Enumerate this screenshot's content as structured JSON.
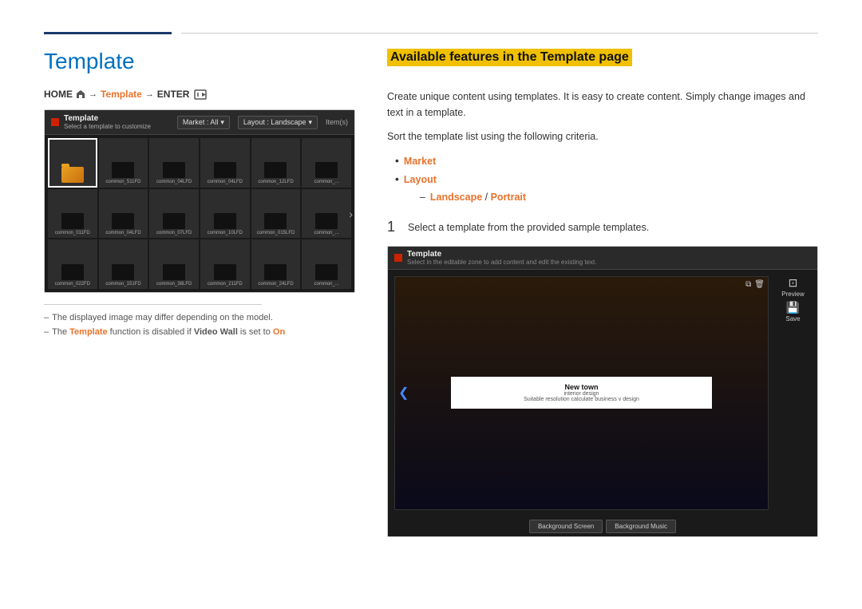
{
  "page": {
    "title": "Template",
    "top_rule_left_width": 160,
    "breadcrumb": {
      "home": "HOME",
      "arrow1": "→",
      "link": "Template",
      "arrow2": "→",
      "enter": "ENTER"
    }
  },
  "left": {
    "mockup": {
      "title": "Template",
      "subtitle": "Select a template to customize",
      "market_dropdown": "Market : All",
      "layout_dropdown": "Layout : Landscape",
      "items_label": "Item(s)",
      "thumbs": [
        {
          "label": "",
          "type": "folder"
        },
        {
          "label": "common_511FD",
          "type": "screen"
        },
        {
          "label": "common_04LFD",
          "type": "screen"
        },
        {
          "label": "common_04LFD",
          "type": "screen"
        },
        {
          "label": "common_12LFD",
          "type": "screen"
        },
        {
          "label": "common_...",
          "type": "screen"
        },
        {
          "label": "common_011FD",
          "type": "screen"
        },
        {
          "label": "common_04LFD",
          "type": "screen"
        },
        {
          "label": "common_07LFD",
          "type": "screen"
        },
        {
          "label": "common_10LFD",
          "type": "screen"
        },
        {
          "label": "common_015LFD",
          "type": "screen"
        },
        {
          "label": "common_...",
          "type": "screen"
        },
        {
          "label": "common_022FD",
          "type": "screen"
        },
        {
          "label": "common_151FD",
          "type": "screen"
        },
        {
          "label": "common_38LFD",
          "type": "screen"
        },
        {
          "label": "common_211FD",
          "type": "screen"
        },
        {
          "label": "common_24LFD",
          "type": "screen"
        },
        {
          "label": "common_...",
          "type": "screen"
        }
      ]
    },
    "notes": [
      {
        "text": "The displayed image may differ depending on the model."
      },
      {
        "text": "The ",
        "highlight_word": "Template",
        "rest": " function is disabled if ",
        "bold_word": "Video Wall",
        "rest2": " is set to ",
        "on_word": "On"
      }
    ]
  },
  "right": {
    "section_title": "Available features in the Template page",
    "description": "Create unique content using templates. It is easy to create content. Simply change images and text in a template.",
    "sort_text": "Sort the template list using the following criteria.",
    "bullets": [
      {
        "label": "Market"
      },
      {
        "label": "Layout",
        "sub": [
          "Landscape / Portrait"
        ]
      }
    ],
    "step1_number": "1",
    "step1_text": "Select a template from the provided sample templates.",
    "mockup2": {
      "title": "Template",
      "subtitle": "Select in the editable zone to add content and edit the existing text.",
      "preview_title": "New town",
      "preview_subtitle": "interior design",
      "preview_tagline": "Suitable resolution calculate business v design",
      "btn_background_screen": "Background Screen",
      "btn_background_music": "Background Music",
      "sidebar_preview": "Preview",
      "sidebar_save": "Save"
    }
  }
}
